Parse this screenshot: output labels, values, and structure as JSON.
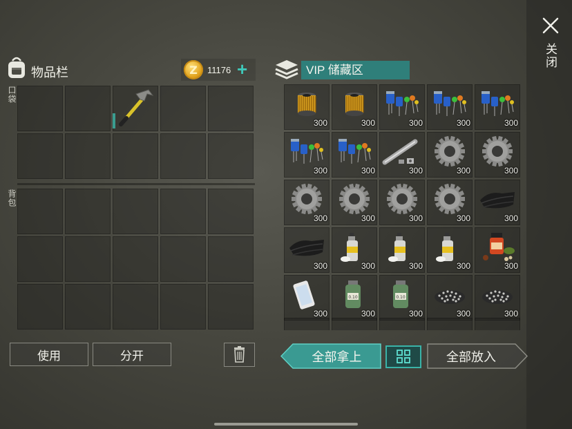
{
  "close": {
    "label": "关闭"
  },
  "inventory": {
    "title": "物品栏",
    "coins": "11176",
    "pocket_label": "口袋",
    "backpack_label": "背包",
    "use_button": "使用",
    "split_button": "分开"
  },
  "vip": {
    "title": "VIP 储藏区",
    "items": [
      {
        "icon": "oil-filter-icon",
        "qty": "300"
      },
      {
        "icon": "oil-filter-icon",
        "qty": "300"
      },
      {
        "icon": "electronic-components-icon",
        "qty": "300"
      },
      {
        "icon": "electronic-components-icon",
        "qty": "300"
      },
      {
        "icon": "electronic-components-icon",
        "qty": "300"
      },
      {
        "icon": "electronic-components-icon",
        "qty": "300"
      },
      {
        "icon": "electronic-components-icon",
        "qty": "300"
      },
      {
        "icon": "pipe-parts-icon",
        "qty": "300"
      },
      {
        "icon": "gear-icon",
        "qty": "300"
      },
      {
        "icon": "gear-icon",
        "qty": "300"
      },
      {
        "icon": "gear-icon",
        "qty": "300"
      },
      {
        "icon": "gear-icon",
        "qty": "300"
      },
      {
        "icon": "gear-icon",
        "qty": "300"
      },
      {
        "icon": "gear-icon",
        "qty": "300"
      },
      {
        "icon": "rubber-sheet-icon",
        "qty": "300"
      },
      {
        "icon": "rubber-sheet-icon",
        "qty": "300"
      },
      {
        "icon": "spray-paint-icon",
        "qty": "300"
      },
      {
        "icon": "spray-paint-icon",
        "qty": "300"
      },
      {
        "icon": "spray-paint-icon",
        "qty": "300"
      },
      {
        "icon": "spices-icon",
        "qty": "300"
      },
      {
        "icon": "smartphone-icon",
        "qty": "300"
      },
      {
        "icon": "chemical-jar-icon",
        "qty": "300"
      },
      {
        "icon": "chemical-jar-icon",
        "qty": "300"
      },
      {
        "icon": "gravel-pile-icon",
        "qty": "300"
      },
      {
        "icon": "gravel-pile-icon",
        "qty": "300"
      }
    ],
    "take_all_button": "全部拿上",
    "put_all_button": "全部放入"
  },
  "colors": {
    "accent": "#3ab3a8",
    "title_bg": "#2f7f7a",
    "coin": "#e0a21c"
  }
}
